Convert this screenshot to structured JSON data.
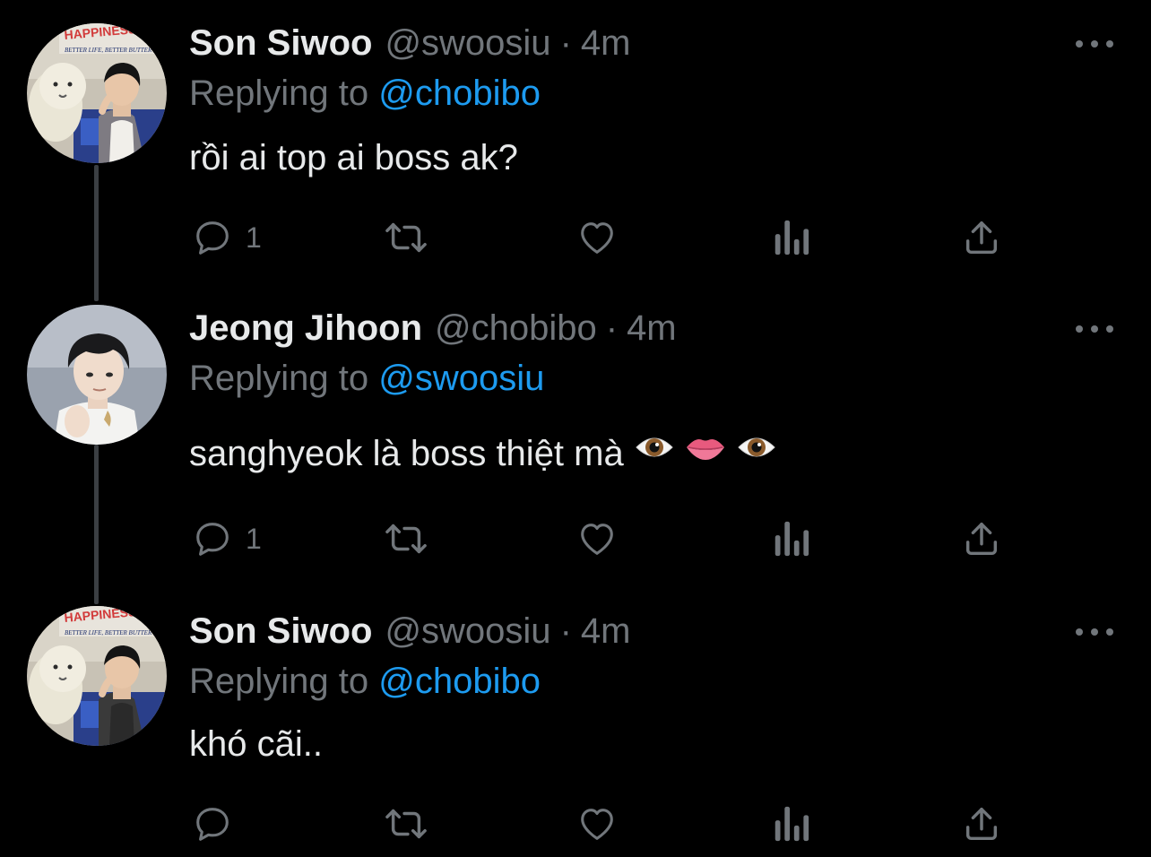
{
  "tweets": [
    {
      "name": "Son Siwoo",
      "handle": "@swoosiu",
      "separator": "·",
      "time": "4m",
      "reply_prefix": "Replying to",
      "reply_to": "@chobibo",
      "text": "rồi ai top ai boss ak?",
      "avatar_sign": "HAPPINESS!",
      "avatar_sign_sub": "BETTER LIFE, BETTER BUTTER",
      "reply_count": "1"
    },
    {
      "name": "Jeong Jihoon",
      "handle": "@chobibo",
      "separator": "·",
      "time": "4m",
      "reply_prefix": "Replying to",
      "reply_to": "@swoosiu",
      "text": "sanghyeok là boss thiệt mà",
      "emojis": [
        "eye-emoji",
        "lips-emoji",
        "eye-emoji"
      ],
      "reply_count": "1"
    },
    {
      "name": "Son Siwoo",
      "handle": "@swoosiu",
      "separator": "·",
      "time": "4m",
      "reply_prefix": "Replying to",
      "reply_to": "@chobibo",
      "text": "khó cãi..",
      "avatar_sign": "HAPPINESS!",
      "avatar_sign_sub": "BETTER LIFE, BETTER BUTTER",
      "reply_count": ""
    }
  ],
  "icons": {
    "more": "more-dots-icon",
    "reply": "reply-bubble-icon",
    "retweet": "retweet-icon",
    "like": "heart-icon",
    "views": "analytics-icon",
    "share": "share-icon"
  },
  "colors": {
    "background": "#000000",
    "text": "#e7e9ea",
    "secondary": "#71767b",
    "mention": "#1d9bf0",
    "thread_line": "#3b3f43"
  }
}
